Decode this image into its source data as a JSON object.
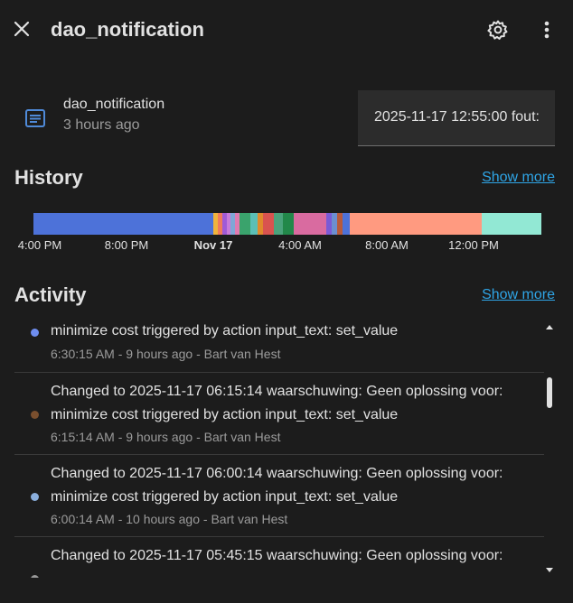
{
  "header": {
    "title": "dao_notification",
    "close_icon": "close-icon",
    "settings_icon": "gear-icon",
    "menu_icon": "more-vertical-icon"
  },
  "entity": {
    "icon": "text-box-icon",
    "name": "dao_notification",
    "last_changed": "3 hours ago",
    "state": "2025-11-17 12:55:00 fout:"
  },
  "history": {
    "title": "History",
    "show_more": "Show more",
    "time_labels": [
      "4:00 PM",
      "8:00 PM",
      "Nov 17",
      "4:00 AM",
      "8:00 AM",
      "12:00 PM"
    ],
    "segment_colors": [
      "#4d72d9",
      "#f0b43c",
      "#f07a5a",
      "#a05ad6",
      "#c87ad8",
      "#7fa7d6",
      "#e07ab0",
      "#3aa36c",
      "#5bbfb6",
      "#e08a2c",
      "#d9534f",
      "#4aa37c",
      "#22884a",
      "#d96ba0",
      "#7a5ad6",
      "#6c8fd0",
      "#b85a3c",
      "#4d72d9",
      "#ff9a80",
      "#92e8d4"
    ]
  },
  "activity": {
    "title": "Activity",
    "show_more": "Show more",
    "items": [
      {
        "line1": "",
        "line2": "minimize cost triggered by action input_text: set_value",
        "meta": "6:30:15 AM - 9 hours ago - Bart van Hest",
        "dot_color": "#6f8ef0"
      },
      {
        "line1": "Changed to 2025-11-17 06:15:14 waarschuwing: Geen oplossing voor:",
        "line2": "minimize cost triggered by action input_text: set_value",
        "meta": "6:15:14 AM - 9 hours ago - Bart van Hest",
        "dot_color": "#7a4f2e"
      },
      {
        "line1": "Changed to 2025-11-17 06:00:14 waarschuwing: Geen oplossing voor:",
        "line2": "minimize cost triggered by action input_text: set_value",
        "meta": "6:00:14 AM - 10 hours ago - Bart van Hest",
        "dot_color": "#8aaedc"
      },
      {
        "line1": "Changed to 2025-11-17 05:45:15 waarschuwing: Geen oplossing voor:",
        "line2": "",
        "meta": "",
        "dot_color": "#9a9a9a"
      }
    ]
  },
  "scrollbar": {
    "up_icon": "triangle-up-icon",
    "down_icon": "triangle-down-icon"
  }
}
